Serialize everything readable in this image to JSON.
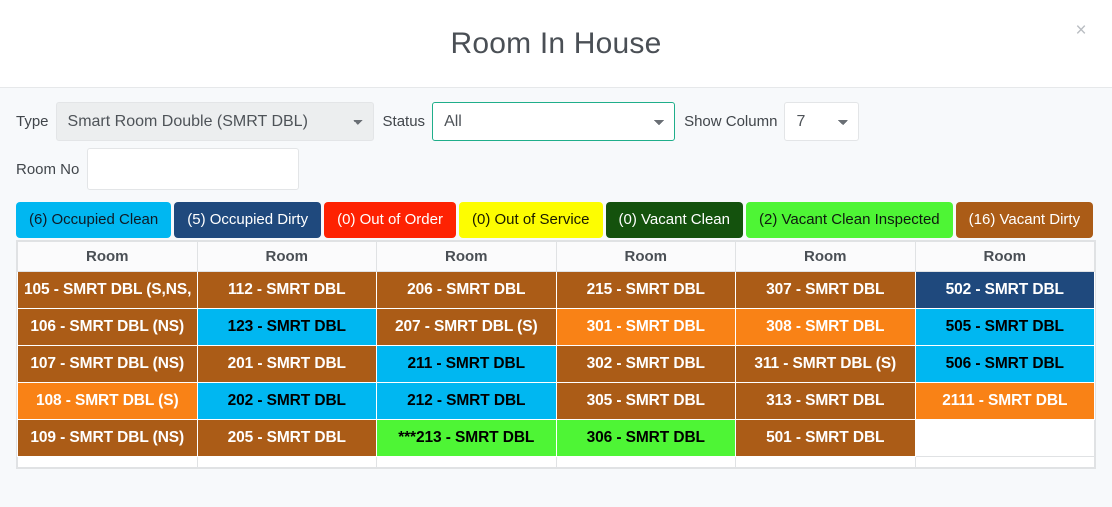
{
  "header": {
    "title": "Room In House",
    "close_label": "×"
  },
  "filters": {
    "type_label": "Type",
    "type_value": "Smart Room Double (SMRT DBL)",
    "type_options": [
      "Smart Room Double (SMRT DBL)"
    ],
    "status_label": "Status",
    "status_value": "All",
    "status_options": [
      "All"
    ],
    "show_column_label": "Show Column",
    "show_column_value": "7",
    "show_column_options": [
      "7"
    ],
    "room_no_label": "Room No",
    "room_no_value": "",
    "room_no_placeholder": ""
  },
  "legend": [
    {
      "label": "(6) Occupied Clean",
      "bg": "#00b7f1",
      "fg": "#0e1a26"
    },
    {
      "label": "(5) Occupied Dirty",
      "bg": "#1f497d",
      "fg": "#ffffff"
    },
    {
      "label": "(0) Out of Order",
      "bg": "#fe2202",
      "fg": "#ffffff"
    },
    {
      "label": "(0) Out of Service",
      "bg": "#fdfd01",
      "fg": "#1a1a00"
    },
    {
      "label": "(0) Vacant Clean",
      "bg": "#14520d",
      "fg": "#ffffff"
    },
    {
      "label": "(2) Vacant Clean Inspected",
      "bg": "#4ef535",
      "fg": "#0e1a0e"
    },
    {
      "label": "(16) Vacant Dirty",
      "bg": "#ab5c17",
      "fg": "#ffffff"
    }
  ],
  "table": {
    "headers": [
      "Room",
      "Room",
      "Room",
      "Room",
      "Room",
      "Room"
    ],
    "colors": {
      "occupied_clean": "#00b7f1",
      "occupied_dirty": "#1f497d",
      "out_of_order": "#fe2202",
      "out_of_service": "#fdfd01",
      "vacant_clean": "#14520d",
      "vacant_clean_inspected": "#4ef535",
      "vacant_dirty": "#ab5c17",
      "orange": "#f98216"
    },
    "rows": [
      [
        {
          "text": "105 - SMRT DBL (S,NS,",
          "bg": "#ab5c17",
          "fg": "#ffffff"
        },
        {
          "text": "112 - SMRT DBL",
          "bg": "#ab5c17",
          "fg": "#ffffff"
        },
        {
          "text": "206 - SMRT DBL",
          "bg": "#ab5c17",
          "fg": "#ffffff"
        },
        {
          "text": "215 - SMRT DBL",
          "bg": "#ab5c17",
          "fg": "#ffffff"
        },
        {
          "text": "307 - SMRT DBL",
          "bg": "#ab5c17",
          "fg": "#ffffff"
        },
        {
          "text": "502 - SMRT DBL",
          "bg": "#1f497d",
          "fg": "#ffffff"
        }
      ],
      [
        {
          "text": "106 - SMRT DBL (NS)",
          "bg": "#ab5c17",
          "fg": "#ffffff"
        },
        {
          "text": "123 - SMRT DBL",
          "bg": "#00b7f1",
          "fg": "#000000"
        },
        {
          "text": "207 - SMRT DBL (S)",
          "bg": "#ab5c17",
          "fg": "#ffffff"
        },
        {
          "text": "301 - SMRT DBL",
          "bg": "#f98216",
          "fg": "#ffffff"
        },
        {
          "text": "308 - SMRT DBL",
          "bg": "#f98216",
          "fg": "#ffffff"
        },
        {
          "text": "505 - SMRT DBL",
          "bg": "#00b7f1",
          "fg": "#000000"
        }
      ],
      [
        {
          "text": "107 - SMRT DBL (NS)",
          "bg": "#ab5c17",
          "fg": "#ffffff"
        },
        {
          "text": "201 - SMRT DBL",
          "bg": "#ab5c17",
          "fg": "#ffffff"
        },
        {
          "text": "211 - SMRT DBL",
          "bg": "#00b7f1",
          "fg": "#000000"
        },
        {
          "text": "302 - SMRT DBL",
          "bg": "#ab5c17",
          "fg": "#ffffff"
        },
        {
          "text": "311 - SMRT DBL (S)",
          "bg": "#ab5c17",
          "fg": "#ffffff"
        },
        {
          "text": "506 - SMRT DBL",
          "bg": "#00b7f1",
          "fg": "#000000"
        }
      ],
      [
        {
          "text": "108 - SMRT DBL (S)",
          "bg": "#f98216",
          "fg": "#ffffff"
        },
        {
          "text": "202 - SMRT DBL",
          "bg": "#00b7f1",
          "fg": "#000000"
        },
        {
          "text": "212 - SMRT DBL",
          "bg": "#00b7f1",
          "fg": "#000000"
        },
        {
          "text": "305 - SMRT DBL",
          "bg": "#ab5c17",
          "fg": "#ffffff"
        },
        {
          "text": "313 - SMRT DBL",
          "bg": "#ab5c17",
          "fg": "#ffffff"
        },
        {
          "text": "2111 - SMRT DBL",
          "bg": "#f98216",
          "fg": "#ffffff"
        }
      ],
      [
        {
          "text": "109 - SMRT DBL (NS)",
          "bg": "#ab5c17",
          "fg": "#ffffff"
        },
        {
          "text": "205 - SMRT DBL",
          "bg": "#ab5c17",
          "fg": "#ffffff"
        },
        {
          "text": "***213 - SMRT DBL",
          "bg": "#4ef535",
          "fg": "#000000"
        },
        {
          "text": "306 - SMRT DBL",
          "bg": "#4ef535",
          "fg": "#000000"
        },
        {
          "text": "501 - SMRT DBL",
          "bg": "#ab5c17",
          "fg": "#ffffff"
        },
        {
          "text": "",
          "bg": "#ffffff",
          "fg": "#000000",
          "empty": true
        }
      ]
    ]
  }
}
